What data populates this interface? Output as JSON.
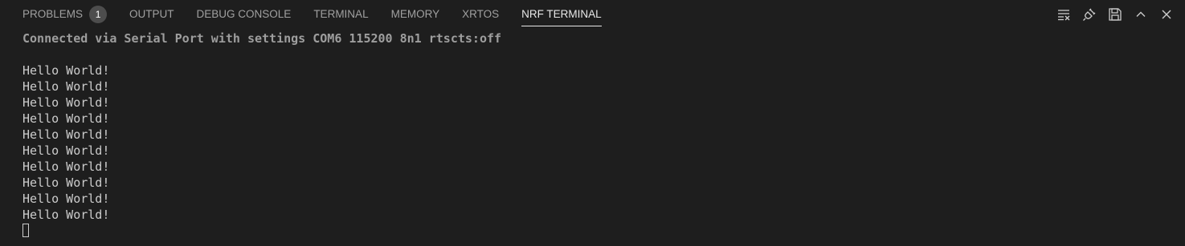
{
  "tabs": [
    {
      "label": "PROBLEMS",
      "badge": "1",
      "active": false
    },
    {
      "label": "OUTPUT",
      "active": false
    },
    {
      "label": "DEBUG CONSOLE",
      "active": false
    },
    {
      "label": "TERMINAL",
      "active": false
    },
    {
      "label": "MEMORY",
      "active": false
    },
    {
      "label": "XRTOS",
      "active": false
    },
    {
      "label": "NRF TERMINAL",
      "active": true
    }
  ],
  "actions": [
    {
      "icon": "clear-output-icon"
    },
    {
      "icon": "disconnect-plug-icon"
    },
    {
      "icon": "save-icon"
    },
    {
      "icon": "chevron-up-icon"
    },
    {
      "icon": "close-icon"
    }
  ],
  "terminal": {
    "status": "Connected via Serial Port with settings COM6 115200 8n1 rtscts:off",
    "lines": [
      "Hello World!",
      "Hello World!",
      "Hello World!",
      "Hello World!",
      "Hello World!",
      "Hello World!",
      "Hello World!",
      "Hello World!",
      "Hello World!",
      "Hello World!"
    ]
  },
  "colors": {
    "background": "#1e1e1e",
    "tab_inactive": "#a0a0a0",
    "tab_active": "#e7e7e7",
    "badge_bg": "#4d4d4d",
    "terminal_text": "#cccccc"
  }
}
